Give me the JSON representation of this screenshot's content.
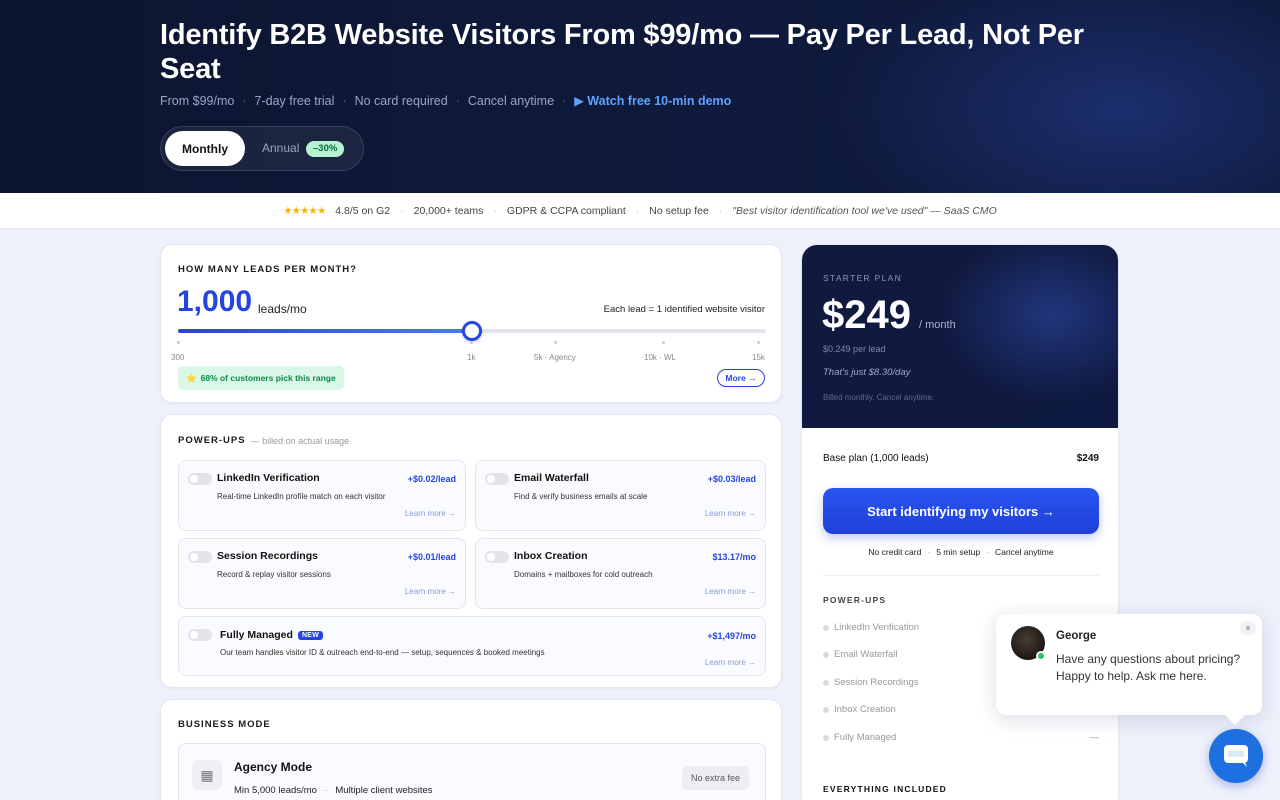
{
  "hero": {
    "title": "Identify B2B Website Visitors From $99/mo — Pay Per Lead, Not Per Seat",
    "sub": [
      "From $99/mo",
      "7-day free trial",
      "No card required",
      "Cancel anytime"
    ],
    "demo": "▶ Watch free 10-min demo",
    "billing": {
      "monthly": "Monthly",
      "annual": "Annual",
      "discount": "–30%",
      "selected": "Monthly"
    }
  },
  "trust": {
    "stars": "★★★★★",
    "rating": "4.8/5 on G2",
    "teams": "20,000+ teams",
    "compliance": "GDPR & CCPA compliant",
    "setup": "No setup fee",
    "quote": "\"Best visitor identification tool we've used\" — SaaS CMO"
  },
  "leads": {
    "label": "HOW MANY LEADS PER MONTH?",
    "value": "1,000",
    "unit": "leads/mo",
    "note": "Each lead = 1 identified website visitor",
    "slider_fraction": 0.5,
    "ticks": [
      "300",
      "1k",
      "5k · Agency",
      "10k · WL",
      "15k"
    ],
    "popular": "68% of customers pick this range",
    "more": "More →"
  },
  "powerups": {
    "label": "POWER-UPS",
    "note": "— billed on actual usage",
    "items": [
      {
        "name": "LinkedIn Verification",
        "desc": "Real-time LinkedIn profile match on each visitor",
        "price": "+$0.02/lead",
        "learn": "Learn more →"
      },
      {
        "name": "Email Waterfall",
        "desc": "Find & verify business emails at scale",
        "price": "+$0.03/lead",
        "learn": "Learn more →"
      },
      {
        "name": "Session Recordings",
        "desc": "Record & replay visitor sessions",
        "price": "+$0.01/lead",
        "learn": "Learn more →"
      },
      {
        "name": "Inbox Creation",
        "desc": "Domains + mailboxes for cold outreach",
        "price": "$13.17/mo",
        "learn": "Learn more →"
      },
      {
        "name": "Fully Managed",
        "badge": "NEW",
        "desc": "Our team handles visitor ID & outreach end-to-end — setup, sequences & booked meetings",
        "price": "+$1,497/mo",
        "learn": "Learn more →"
      }
    ]
  },
  "business": {
    "label": "BUSINESS MODE",
    "agency_title": "Agency Mode",
    "agency_sub_1": "Min 5,000 leads/mo",
    "agency_sub_2": "Multiple client websites",
    "agency_fee": "No extra fee"
  },
  "plan": {
    "label": "STARTER PLAN",
    "price": "$249",
    "per": "/ month",
    "per_lead": "$0.249 per lead",
    "daily": "That's just $8.30/day",
    "billed": "Billed monthly. Cancel anytime.",
    "base_label": "Base plan (1,000 leads)",
    "base_value": "$249",
    "cta": "Start identifying my visitors →",
    "cta_notes": [
      "No credit card",
      "5 min setup",
      "Cancel anytime"
    ],
    "powerups_label": "POWER-UPS",
    "powerups": [
      "LinkedIn Verification",
      "Email Waterfall",
      "Session Recordings",
      "Inbox Creation",
      "Fully Managed"
    ],
    "fully_managed_value": "—",
    "everything_label": "EVERYTHING INCLUDED"
  },
  "chat": {
    "agent": "George",
    "message": "Have any questions about pricing? Happy to help. Ask me here.",
    "close": "×"
  }
}
